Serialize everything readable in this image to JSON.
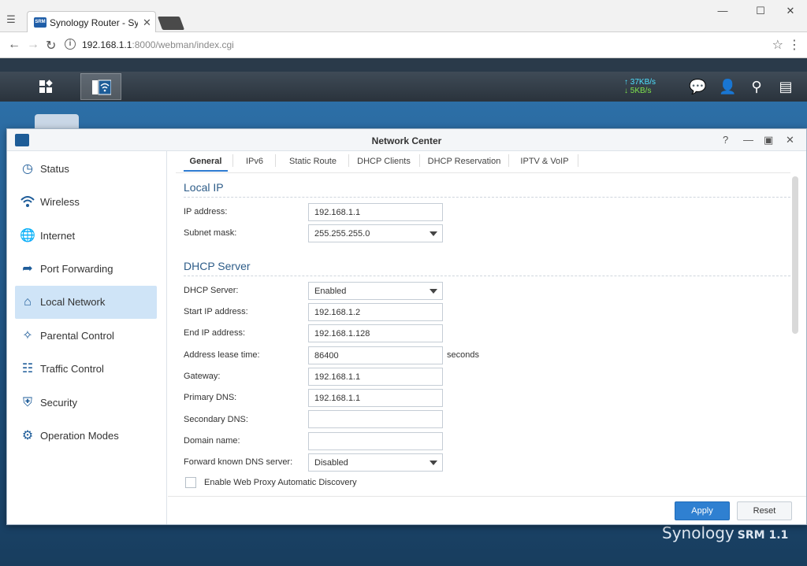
{
  "browser": {
    "tab_title": "Synology Router - Synolo",
    "tab_favicon": "SRM",
    "url_host": "192.168.1.1",
    "url_rest": ":8000/webman/index.cgi"
  },
  "taskbar": {
    "upload_speed": "37KB/s",
    "download_speed": "5KB/s"
  },
  "window": {
    "title": "Network Center"
  },
  "sidebar": {
    "items": [
      {
        "label": "Status",
        "icon": "gauge-icon"
      },
      {
        "label": "Wireless",
        "icon": "wifi-icon"
      },
      {
        "label": "Internet",
        "icon": "globe-icon"
      },
      {
        "label": "Port Forwarding",
        "icon": "forward-arrow-icon"
      },
      {
        "label": "Local Network",
        "icon": "home-network-icon"
      },
      {
        "label": "Parental Control",
        "icon": "family-icon"
      },
      {
        "label": "Traffic Control",
        "icon": "sliders-icon"
      },
      {
        "label": "Security",
        "icon": "shield-icon"
      },
      {
        "label": "Operation Modes",
        "icon": "router-gear-icon"
      }
    ],
    "active_index": 4
  },
  "tabs": [
    "General",
    "IPv6",
    "Static Route",
    "DHCP Clients",
    "DHCP Reservation",
    "IPTV & VoIP"
  ],
  "local_ip": {
    "heading": "Local IP",
    "ip_label": "IP address:",
    "ip_value": "192.168.1.1",
    "mask_label": "Subnet mask:",
    "mask_value": "255.255.255.0"
  },
  "dhcp": {
    "heading": "DHCP Server",
    "server_label": "DHCP Server:",
    "server_value": "Enabled",
    "start_label": "Start IP address:",
    "start_value": "192.168.1.2",
    "end_label": "End IP address:",
    "end_value": "192.168.1.128",
    "lease_label": "Address lease time:",
    "lease_value": "86400",
    "lease_unit": "seconds",
    "gateway_label": "Gateway:",
    "gateway_value": "192.168.1.1",
    "pdns_label": "Primary DNS:",
    "pdns_value": "192.168.1.1",
    "sdns_label": "Secondary DNS:",
    "sdns_value": "",
    "domain_label": "Domain name:",
    "domain_value": "",
    "fwd_label": "Forward known DNS server:",
    "fwd_value": "Disabled",
    "wpad_label": "Enable Web Proxy Automatic Discovery",
    "wpad_checked": false
  },
  "buttons": {
    "apply": "Apply",
    "reset": "Reset"
  },
  "brand": {
    "name": "Synology",
    "product": "SRM 1.1"
  }
}
